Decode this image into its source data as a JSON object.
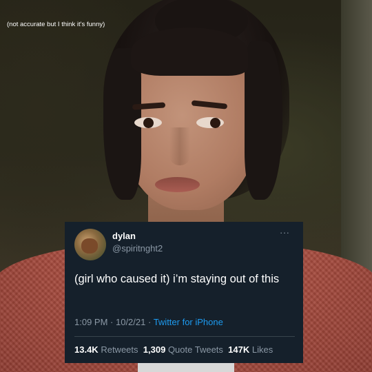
{
  "caption": "(not accurate but I think it's funny)",
  "tweet": {
    "display_name": "dylan",
    "handle": "@spiritnght2",
    "more_icon": "···",
    "text": "(girl who caused it) i’m staying out of this",
    "time": "1:09 PM",
    "separator": " · ",
    "date": "10/2/21",
    "source": "Twitter for iPhone",
    "retweets_count": "13.4K",
    "retweets_label": "Retweets",
    "quote_tweets_count": "1,309",
    "quote_tweets_label": "Quote Tweets",
    "likes_count": "147K",
    "likes_label": "Likes"
  },
  "colors": {
    "tweet_bg": "#15202b",
    "muted_text": "#8b98a5",
    "link_blue": "#1d9bf0",
    "sweater": "#a44a3d"
  }
}
